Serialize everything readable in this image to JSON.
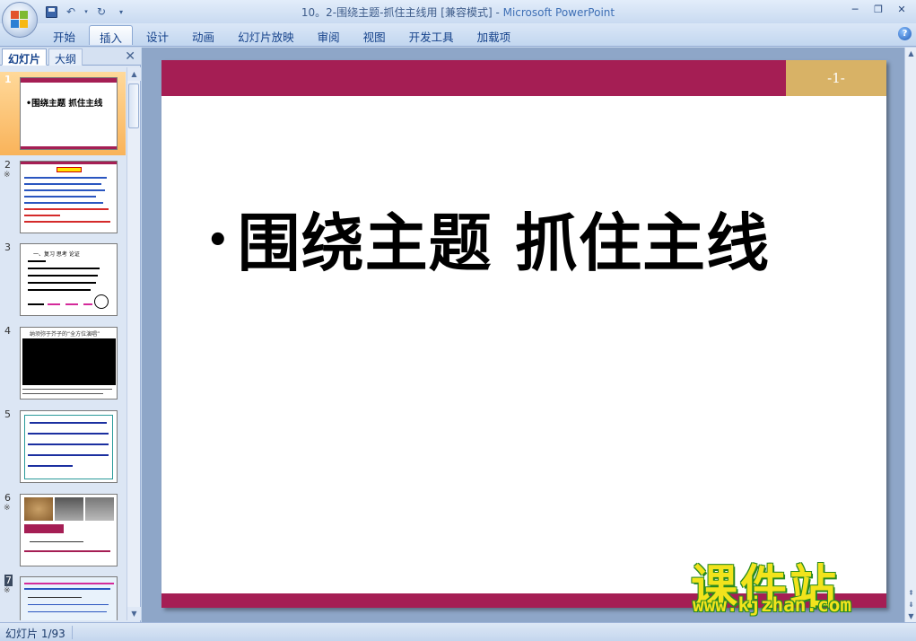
{
  "window": {
    "title": "10。2-围绕主题-抓住主线用 [兼容模式] - Microsoft PowerPoint"
  },
  "ribbon": {
    "tabs": [
      "开始",
      "插入",
      "设计",
      "动画",
      "幻灯片放映",
      "审阅",
      "视图",
      "开发工具",
      "加载项"
    ],
    "active_tab": "插入"
  },
  "pane": {
    "tab_slides": "幻灯片",
    "tab_outline": "大纲",
    "close": "✕",
    "thumbnails": [
      {
        "num": "1",
        "star": "",
        "text": "•围绕主题  抓住主线"
      },
      {
        "num": "2",
        "star": "※"
      },
      {
        "num": "3",
        "star": "",
        "text": "一、复习   思考    论证"
      },
      {
        "num": "4",
        "star": "",
        "text": "纳须弥于芥子的“全方位演唱”"
      },
      {
        "num": "5",
        "star": ""
      },
      {
        "num": "6",
        "star": "※"
      },
      {
        "num": "7",
        "star": "※"
      }
    ]
  },
  "slide": {
    "number": "-1-",
    "title": "围绕主题  抓住主线",
    "bullet": "•"
  },
  "status": {
    "slide_info": "幻灯片 1/93"
  },
  "watermark": {
    "brand": "课件站",
    "url": "www.kjzhan.com"
  },
  "colors": {
    "accent": "#a51e54",
    "gold": "#d8b266"
  }
}
